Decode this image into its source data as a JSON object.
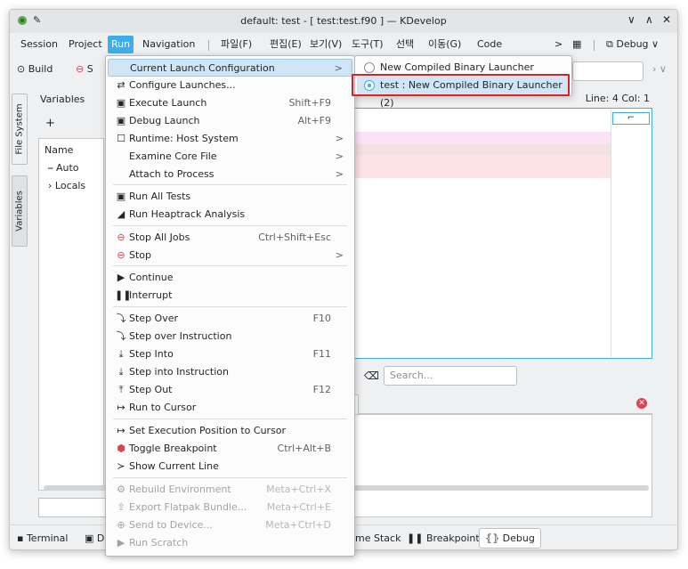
{
  "window": {
    "title": "default: test - [ test:test.f90 ] — KDevelop"
  },
  "menubar": {
    "items": [
      "Session",
      "Project",
      "Run",
      "Navigation",
      "파일(F)",
      "편집(E)",
      "보기(V)",
      "도구(T)",
      "선택",
      "이동(G)",
      "Code"
    ],
    "more_arrow": ">",
    "debug_label": "Debug"
  },
  "toolbar": {
    "build": "Build",
    "stop_short": "S"
  },
  "dock_tabs": {
    "file_system": "File System",
    "variables": "Variables"
  },
  "variables": {
    "header": "Variables",
    "column_name": "Name",
    "rows": [
      "Auto",
      "Locals"
    ]
  },
  "editor": {
    "status": "Line: 4 Col: 1"
  },
  "lower": {
    "search_placeholder": "Search..."
  },
  "bottom_tabs": [
    "Terminal",
    "D",
    "me Stack",
    "Breakpoints",
    "Debug"
  ],
  "run_menu": {
    "items": [
      {
        "icon": "",
        "label": "Current Launch Configuration",
        "shortcut": "",
        "arrow": ">",
        "enabled": true
      },
      {
        "icon": "⇄",
        "label": "Configure Launches...",
        "shortcut": "",
        "arrow": "",
        "enabled": true
      },
      {
        "icon": "▣",
        "label": "Execute Launch",
        "shortcut": "Shift+F9",
        "arrow": "",
        "enabled": true
      },
      {
        "icon": "▣",
        "label": "Debug Launch",
        "shortcut": "Alt+F9",
        "arrow": "",
        "enabled": true
      },
      {
        "icon": "☐",
        "label": "Runtime: Host System",
        "shortcut": "",
        "arrow": ">",
        "enabled": true
      },
      {
        "icon": "",
        "label": "Examine Core File",
        "shortcut": "",
        "arrow": ">",
        "enabled": true
      },
      {
        "icon": "",
        "label": "Attach to Process",
        "shortcut": "",
        "arrow": ">",
        "enabled": true
      },
      {
        "icon": "▣",
        "label": "Run All Tests",
        "shortcut": "",
        "arrow": "",
        "enabled": true
      },
      {
        "icon": "◢",
        "label": "Run Heaptrack Analysis",
        "shortcut": "",
        "arrow": "",
        "enabled": true
      },
      {
        "icon": "⊖",
        "label": "Stop All Jobs",
        "shortcut": "Ctrl+Shift+Esc",
        "arrow": "",
        "enabled": true
      },
      {
        "icon": "⊖",
        "label": "Stop",
        "shortcut": "",
        "arrow": ">",
        "enabled": true
      },
      {
        "icon": "▶",
        "label": "Continue",
        "shortcut": "",
        "arrow": "",
        "enabled": true
      },
      {
        "icon": "❚❚",
        "label": "Interrupt",
        "shortcut": "",
        "arrow": "",
        "enabled": true
      },
      {
        "icon": "⤵",
        "label": "Step Over",
        "shortcut": "F10",
        "arrow": "",
        "enabled": true
      },
      {
        "icon": "⤵",
        "label": "Step over Instruction",
        "shortcut": "",
        "arrow": "",
        "enabled": true
      },
      {
        "icon": "⤓",
        "label": "Step Into",
        "shortcut": "F11",
        "arrow": "",
        "enabled": true
      },
      {
        "icon": "⤓",
        "label": "Step into Instruction",
        "shortcut": "",
        "arrow": "",
        "enabled": true
      },
      {
        "icon": "⤒",
        "label": "Step Out",
        "shortcut": "F12",
        "arrow": "",
        "enabled": true
      },
      {
        "icon": "↦",
        "label": "Run to Cursor",
        "shortcut": "",
        "arrow": "",
        "enabled": true
      },
      {
        "icon": "↦",
        "label": "Set Execution Position to Cursor",
        "shortcut": "",
        "arrow": "",
        "enabled": true
      },
      {
        "icon": "⬢",
        "label": "Toggle Breakpoint",
        "shortcut": "Ctrl+Alt+B",
        "arrow": "",
        "enabled": true
      },
      {
        "icon": "≻",
        "label": "Show Current Line",
        "shortcut": "",
        "arrow": "",
        "enabled": true
      },
      {
        "icon": "⚙",
        "label": "Rebuild Environment",
        "shortcut": "Meta+Ctrl+X",
        "arrow": "",
        "enabled": false
      },
      {
        "icon": "⇪",
        "label": "Export Flatpak Bundle...",
        "shortcut": "Meta+Ctrl+E",
        "arrow": "",
        "enabled": false
      },
      {
        "icon": "⊕",
        "label": "Send to Device...",
        "shortcut": "Meta+Ctrl+D",
        "arrow": "",
        "enabled": false
      },
      {
        "icon": "▶",
        "label": "Run Scratch",
        "shortcut": "",
        "arrow": "",
        "enabled": false
      }
    ]
  },
  "submenu": {
    "items": [
      {
        "label": "New Compiled Binary Launcher",
        "checked": false
      },
      {
        "label": "test : New Compiled Binary Launcher (2)",
        "checked": true
      }
    ]
  },
  "colors": {
    "accent": "#3daee9",
    "highlight_box": "#e02020"
  }
}
